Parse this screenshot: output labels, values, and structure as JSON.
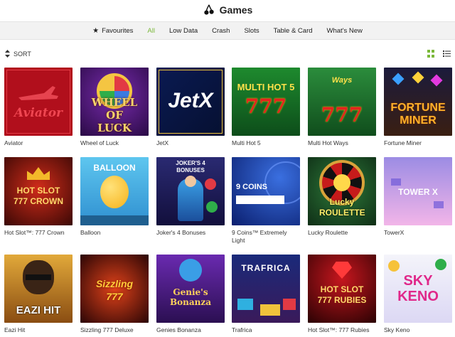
{
  "header": {
    "title": "Games",
    "logo_icon": "cherries-icon"
  },
  "categories": [
    {
      "label": "Favourites",
      "icon": "star-icon",
      "active": false
    },
    {
      "label": "All",
      "active": true
    },
    {
      "label": "Low Data",
      "active": false
    },
    {
      "label": "Crash",
      "active": false
    },
    {
      "label": "Slots",
      "active": false
    },
    {
      "label": "Table & Card",
      "active": false
    },
    {
      "label": "What's New",
      "active": false
    }
  ],
  "sort": {
    "label": "SORT"
  },
  "view": {
    "grid_icon": "grid-view-icon",
    "list_icon": "list-view-icon",
    "active": "grid",
    "accent": "#7bb83a"
  },
  "games": [
    {
      "name": "Aviator",
      "art": "Aviator"
    },
    {
      "name": "Wheel of Luck",
      "art": "WHEEL OF LUCK"
    },
    {
      "name": "JetX",
      "art": "JetX"
    },
    {
      "name": "Multi Hot 5",
      "art": "MULTI HOT 5"
    },
    {
      "name": "Multi Hot Ways",
      "art": "777"
    },
    {
      "name": "Fortune Miner",
      "art": "FORTUNE MINER"
    },
    {
      "name": "Hot Slot™: 777 Crown",
      "art": "HOT SLOT 777 CROWN"
    },
    {
      "name": "Balloon",
      "art": "BALLOON"
    },
    {
      "name": "Joker's 4 Bonuses",
      "art": "JOKER'S 4 BONUSES"
    },
    {
      "name": "9 Coins™ Extremely Light",
      "art": "9 COINS"
    },
    {
      "name": "Lucky Roulette",
      "art": "Lucky ROULETTE"
    },
    {
      "name": "TowerX",
      "art": "TOWER X"
    },
    {
      "name": "Eazi Hit",
      "art": "EAZI HIT"
    },
    {
      "name": "Sizzling 777 Deluxe",
      "art": "Sizzling 777"
    },
    {
      "name": "Genies Bonanza",
      "art": "Genie's Bonanza"
    },
    {
      "name": "Trafrica",
      "art": "TRAFRICA"
    },
    {
      "name": "Hot Slot™: 777 Rubies",
      "art": "HOT SLOT 777 RUBIES"
    },
    {
      "name": "Sky Keno",
      "art": "SKY KENO"
    }
  ]
}
